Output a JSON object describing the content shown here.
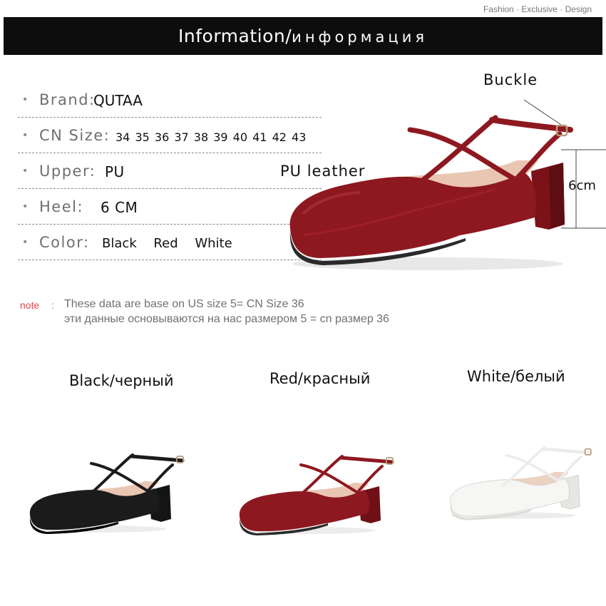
{
  "header": {
    "tagline": "Fashion · Exclusive · Design",
    "title_en": "Information/",
    "title_ru": "информация"
  },
  "specs": {
    "brand": {
      "label": "Brand:",
      "value": "QUTAA"
    },
    "size": {
      "label": "CN Size:",
      "value": "34 35 36 37 38 39 40 41 42 43"
    },
    "upper": {
      "label": "Upper:",
      "value": "PU"
    },
    "heel": {
      "label": "Heel:",
      "value": "6 CM"
    },
    "color": {
      "label": "Color:",
      "value": "Black Red White"
    }
  },
  "callouts": {
    "buckle": "Buckle",
    "material": "PU leather",
    "height": "6cm"
  },
  "note": {
    "tag": "note",
    "line_en": "These data are base on US size 5= CN Size 36",
    "line_ru": "эти данные основываются на нас размером 5 = cn размер 36"
  },
  "variants": [
    {
      "label": "Black/черный",
      "color": "#1b1b1b"
    },
    {
      "label": "Red/красный",
      "color": "#8e1820"
    },
    {
      "label": "White/белый",
      "color": "#f4f4f2"
    }
  ],
  "colors": {
    "banner": "#0d0d0d",
    "note_tag": "#d9474a",
    "label_gray": "#6f6f6f"
  }
}
